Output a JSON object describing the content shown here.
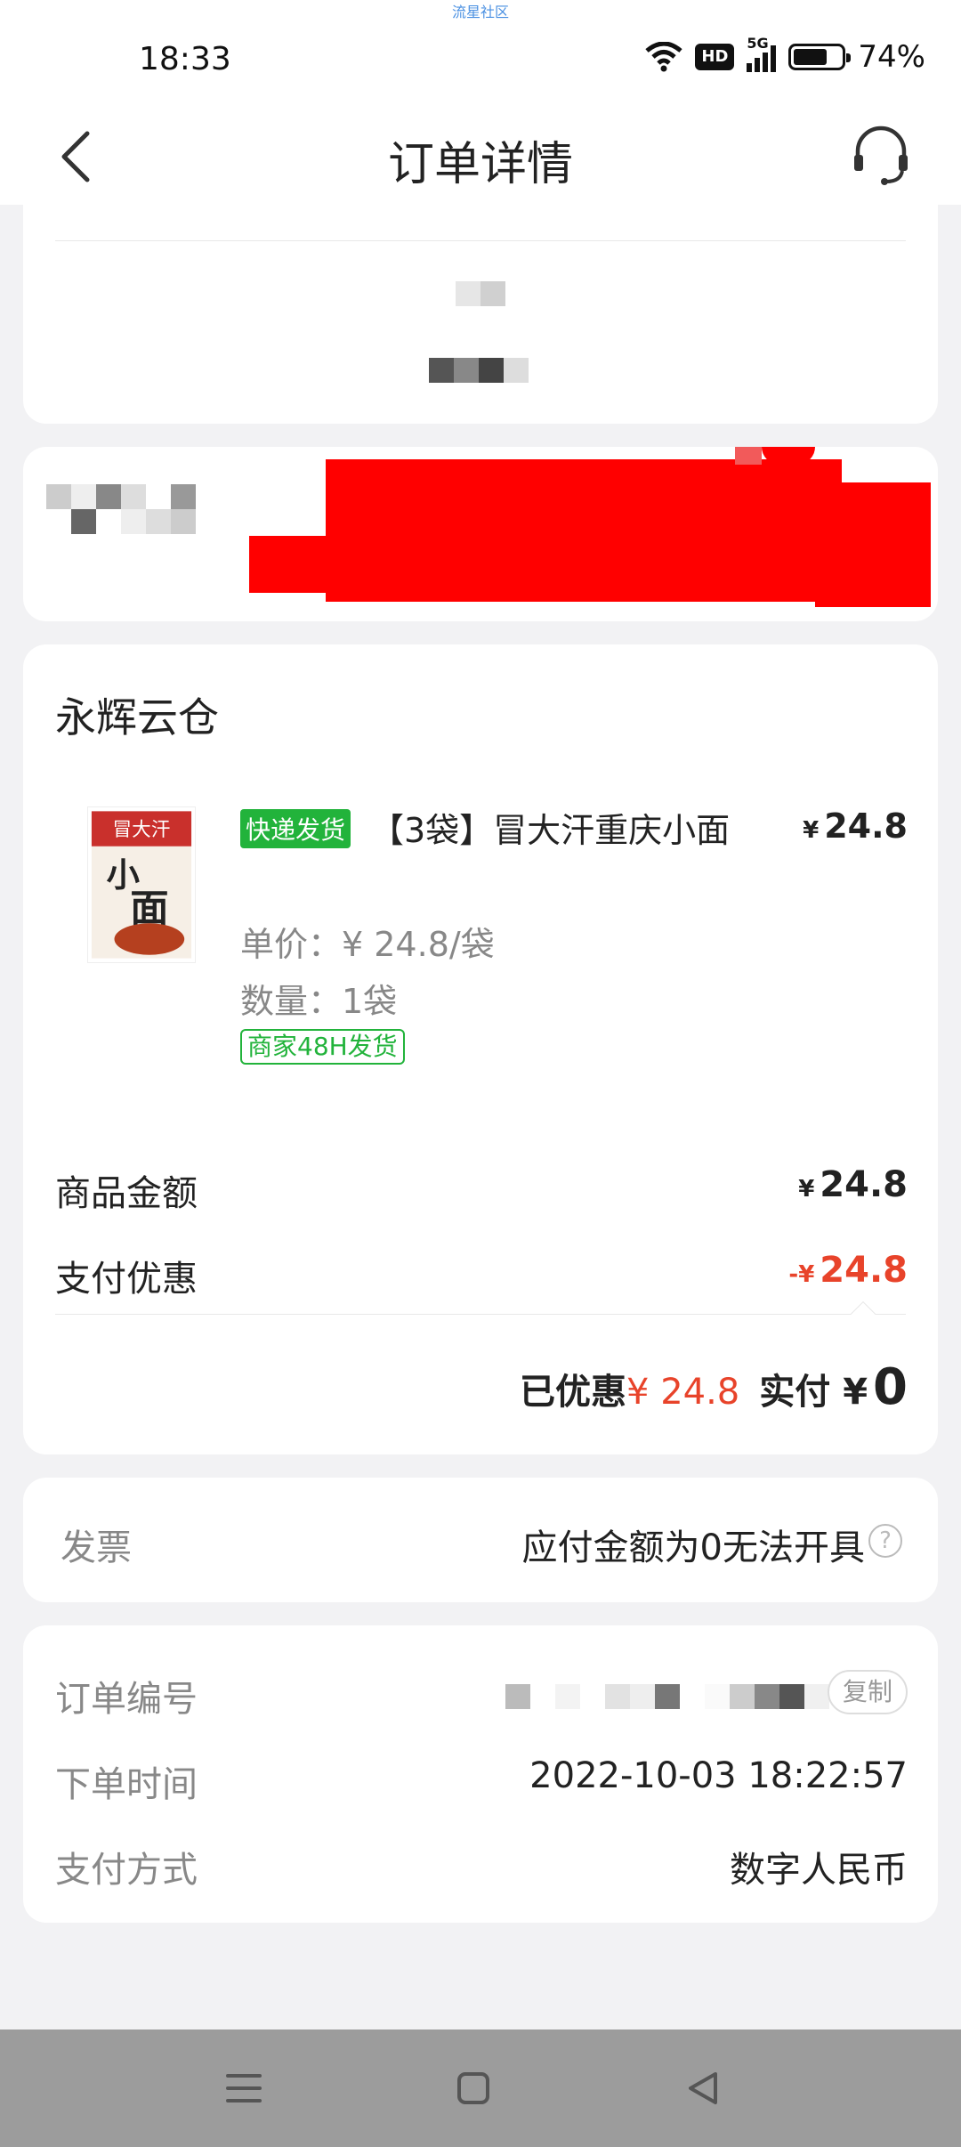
{
  "status_bar": {
    "watermark": "流星社区",
    "time": "18:33",
    "hd": "HD",
    "network": "5G",
    "battery_level": 0.74,
    "battery_text": "74%"
  },
  "nav": {
    "title": "订单详情",
    "back_icon": "chevron-left-icon",
    "service_icon": "headset-icon"
  },
  "store": {
    "name": "永辉云仓"
  },
  "product": {
    "express_tag": "快递发货",
    "name": "【3袋】冒大汗重庆小面",
    "price_symbol": "¥",
    "price": "24.8",
    "unit_price": "单价：¥ 24.8/袋",
    "quantity": "数量：1袋",
    "ship_tag": "商家48H发货",
    "thumb_text": "冒大汗"
  },
  "summary": {
    "goods_label": "商品金额",
    "goods_symbol": "¥",
    "goods_value": "24.8",
    "discount_label": "支付优惠",
    "discount_symbol": "-¥",
    "discount_value": "24.8",
    "saved_label": "已优惠",
    "saved_value": "¥ 24.8",
    "paid_label": "实付 ¥",
    "paid_value": "0"
  },
  "invoice": {
    "label": "发票",
    "value": "应付金额为0无法开具",
    "help_icon": "question-circle-icon"
  },
  "order_info": {
    "number_label": "订单编号",
    "copy_label": "复制",
    "time_label": "下单时间",
    "time_value": "2022-10-03 18:22:57",
    "payment_label": "支付方式",
    "payment_value": "数字人民币"
  },
  "colors": {
    "accent_red": "#e8432a",
    "tag_green": "#22b33b",
    "redaction": "#ff0000"
  }
}
